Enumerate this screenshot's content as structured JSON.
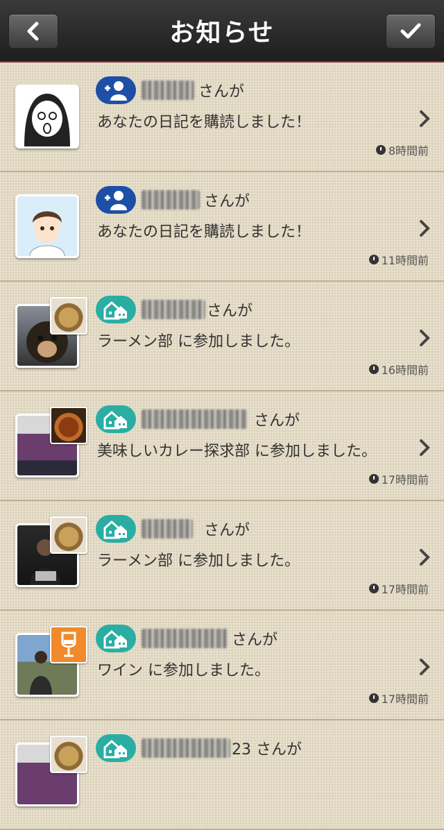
{
  "header": {
    "title": "お知らせ"
  },
  "rows": [
    {
      "suffix": "さんが",
      "message": "あなたの日記を購読しました！",
      "time": "8時間前",
      "badge": "follow"
    },
    {
      "suffix": "さんが",
      "message": "あなたの日記を購読しました！",
      "time": "11時間前",
      "badge": "follow"
    },
    {
      "suffix": "さんが",
      "message": "ラーメン部 に参加しました。",
      "time": "16時間前",
      "badge": "club"
    },
    {
      "suffix": "さんが",
      "message": "美味しいカレー探求部 に参加しました。",
      "time": "17時間前",
      "badge": "club"
    },
    {
      "suffix": "さんが",
      "message": "ラーメン部 に参加しました。",
      "time": "17時間前",
      "badge": "club"
    },
    {
      "suffix": "さんが",
      "message": "ワイン に参加しました。",
      "time": "17時間前",
      "badge": "club"
    },
    {
      "suffix": "23 さんが",
      "message": "",
      "time": "",
      "badge": "club"
    }
  ],
  "icons": {
    "back": "chevron-left-icon",
    "done": "check-icon",
    "follow": "add-user-icon",
    "club": "club-house-icon",
    "open": "chevron-right-icon",
    "time": "clock-icon"
  }
}
